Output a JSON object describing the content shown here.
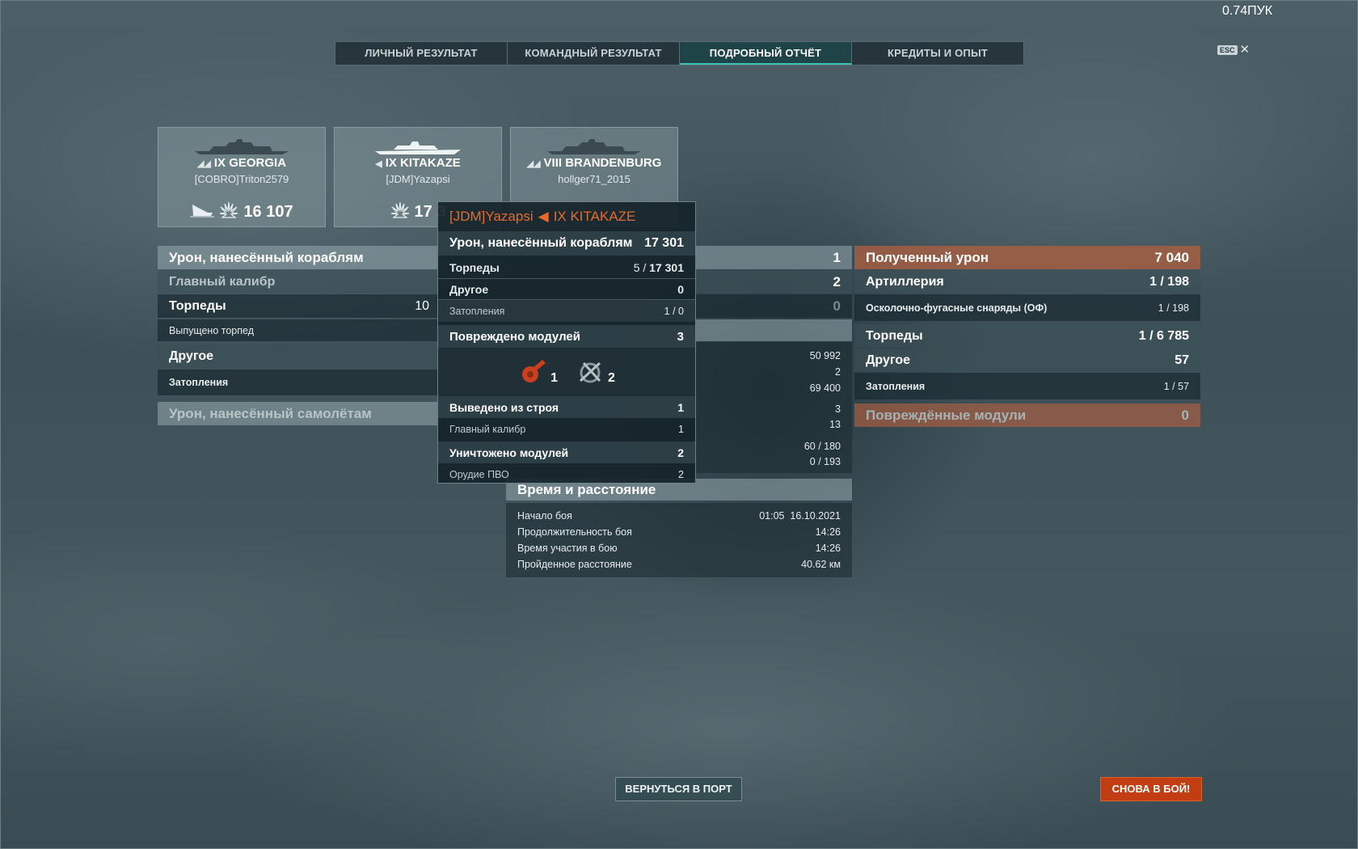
{
  "version": "0.74ПУК",
  "tabs": [
    {
      "label": "ЛИЧНЫЙ РЕЗУЛЬТАТ"
    },
    {
      "label": "КОМАНДНЫЙ РЕЗУЛЬТАТ"
    },
    {
      "label": "ПОДРОБНЫЙ ОТЧЁТ"
    },
    {
      "label": "КРЕДИТЫ И ОПЫТ"
    }
  ],
  "esc_label": "ESC",
  "cards": [
    {
      "tier": "IX",
      "ship": "GEORGIA",
      "player": "[COBRO]Triton2579",
      "damage": "16 107"
    },
    {
      "tier": "IX",
      "ship": "KITAKAZE",
      "player": "[JDM]Yazapsi",
      "damage": "17 3"
    },
    {
      "tier": "VIII",
      "ship": "BRANDENBURG",
      "player": "hollger71_2015",
      "damage": ""
    }
  ],
  "left": {
    "dealt_title": "Урон, нанесённый кораблям",
    "main_caliber": "Главный калибр",
    "torpedoes": "Торпеды",
    "torpedoes_val": "10",
    "torp_launched": "Выпущено торпед",
    "other": "Другое",
    "floods": "Затопления",
    "air_title": "Урон, нанесённый самолётам"
  },
  "center": {
    "vals": [
      "1",
      "2",
      "0"
    ],
    "small_vals": [
      "50 992",
      "2",
      "69 400",
      "3",
      "13",
      "60 / 180",
      "0 / 193"
    ],
    "time_title": "Время и расстояние",
    "time_rows": [
      {
        "label": "Начало боя",
        "value": "01:05  16.10.2021"
      },
      {
        "label": "Продолжительность боя",
        "value": "14:26"
      },
      {
        "label": "Время участия в бою",
        "value": "14:26"
      },
      {
        "label": "Пройденное расстояние",
        "value": "40.62 км"
      }
    ]
  },
  "right": {
    "received_title": "Полученный урон",
    "received_val": "7 040",
    "artillery": "Артиллерия",
    "artillery_val": "1 / 198",
    "he": "Осколочно-фугасные снаряды (ОФ)",
    "he_val": "1 / 198",
    "torpedoes": "Торпеды",
    "torpedoes_val": "1 / 6 785",
    "other": "Другое",
    "other_val": "57",
    "floods": "Затопления",
    "floods_val": "1 / 57",
    "modules": "Повреждённые модули",
    "modules_val": "0"
  },
  "tooltip": {
    "player": "[JDM]Yazapsi",
    "ship": "IX KITAKAZE",
    "dealt": "Урон, нанесённый кораблям",
    "dealt_val": "17 301",
    "torp": "Торпеды",
    "torp_val_a": "5 /",
    "torp_val_b": "17 301",
    "other": "Другое",
    "other_val": "0",
    "floods": "Затопления",
    "floods_val": "1 / 0",
    "mods_dmg": "Повреждено модулей",
    "mods_dmg_val": "3",
    "icon_a_count": "1",
    "icon_b_count": "2",
    "disabled": "Выведено из строя",
    "disabled_val": "1",
    "disabled_main": "Главный калибр",
    "disabled_main_val": "1",
    "destroyed": "Уничтожено модулей",
    "destroyed_val": "2",
    "aa_guns": "Орудие ПВО",
    "aa_guns_val": "2"
  },
  "buttons": {
    "port": "ВЕРНУТЬСЯ В ПОРТ",
    "fight": "СНОВА В БОЙ!"
  },
  "colors": {
    "accent_teal": "#3ec1b4",
    "accent_orange": "#e86a2a",
    "button_red": "#c23d12",
    "received_bar": "#aa5f41"
  }
}
